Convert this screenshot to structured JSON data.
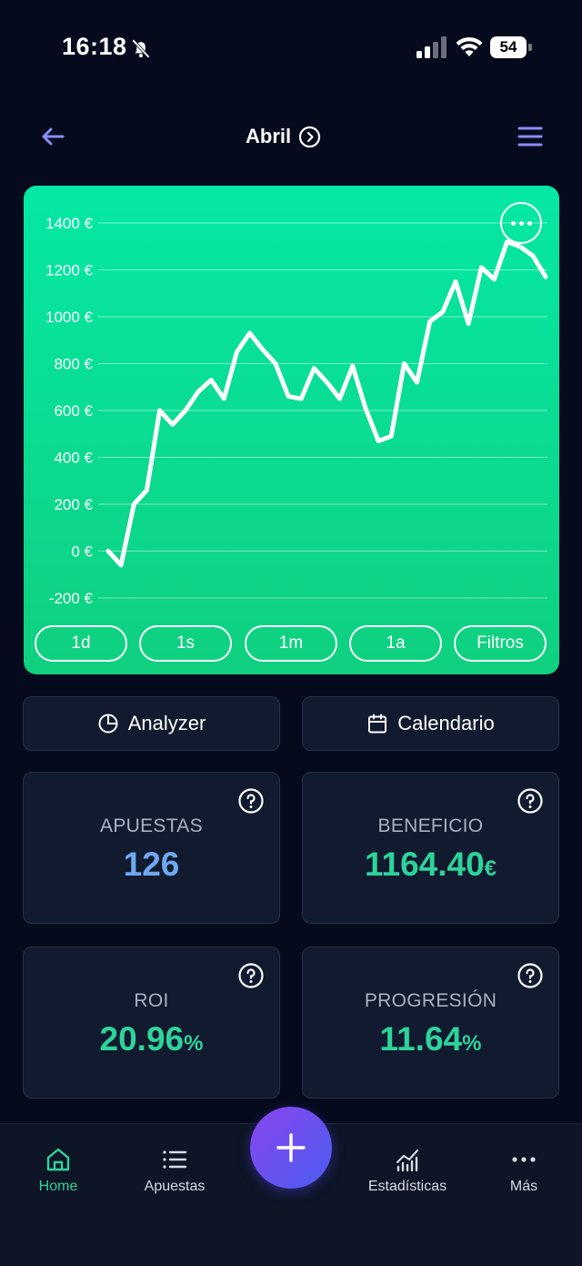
{
  "status_bar": {
    "time": "16:18",
    "battery": "54"
  },
  "header": {
    "title": "Abril"
  },
  "chart_data": {
    "type": "line",
    "ylim": [
      -200,
      1400
    ],
    "y_ticks": [
      "1400 €",
      "1200 €",
      "1000 €",
      "800 €",
      "600 €",
      "400 €",
      "200 €",
      "0 €",
      "-200 €"
    ],
    "y_tick_values": [
      1400,
      1200,
      1000,
      800,
      600,
      400,
      200,
      0,
      -200
    ],
    "grid": true,
    "series": [
      {
        "values": [
          0,
          -60,
          200,
          260,
          600,
          540,
          600,
          680,
          730,
          650,
          850,
          930,
          860,
          800,
          660,
          650,
          780,
          720,
          650,
          790,
          610,
          470,
          490,
          800,
          720,
          980,
          1020,
          1150,
          970,
          1210,
          1160,
          1320,
          1300,
          1260,
          1170
        ]
      }
    ]
  },
  "range_buttons": [
    "1d",
    "1s",
    "1m",
    "1a",
    "Filtros"
  ],
  "actions": {
    "analyzer": "Analyzer",
    "calendar": "Calendario"
  },
  "stats": {
    "apuestas": {
      "label": "APUESTAS",
      "value": "126"
    },
    "beneficio": {
      "label": "BENEFICIO",
      "value": "1164.40",
      "unit": "€"
    },
    "roi": {
      "label": "ROI",
      "value": "20.96",
      "unit": "%"
    },
    "progresion": {
      "label": "PROGRESIÓN",
      "value": "11.64",
      "unit": "%"
    }
  },
  "nav": {
    "home": "Home",
    "bets": "Apuestas",
    "stats": "Estadísticas",
    "more": "Más"
  },
  "colors": {
    "accent_green": "#2ed39a",
    "accent_blue": "#6fa8f0",
    "background": "#050a1c",
    "card": "#111a2e"
  }
}
